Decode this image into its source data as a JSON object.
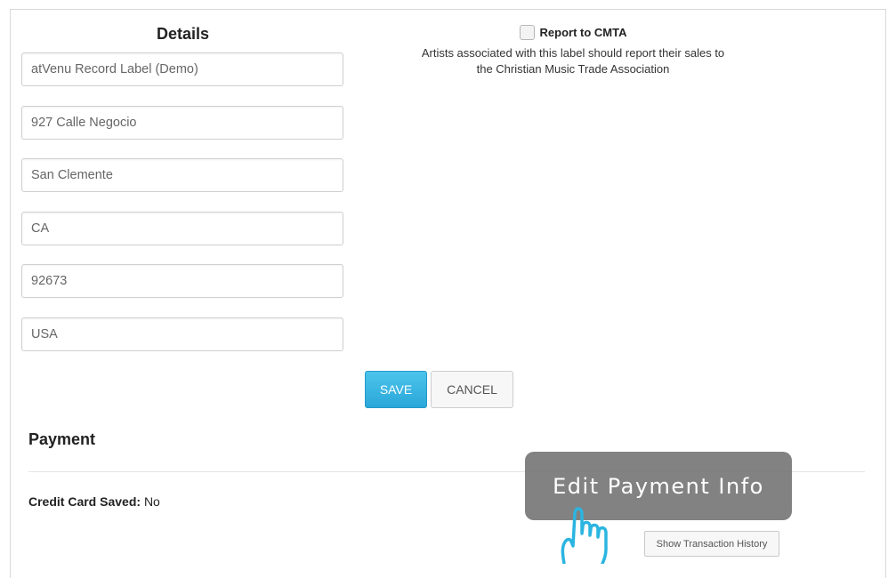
{
  "details": {
    "title": "Details",
    "fields": [
      {
        "value": "atVenu Record Label (Demo)"
      },
      {
        "value": "927 Calle Negocio"
      },
      {
        "value": "San Clemente"
      },
      {
        "value": "CA"
      },
      {
        "value": "92673"
      },
      {
        "value": "USA"
      }
    ]
  },
  "cmta": {
    "checked": false,
    "label": "Report to CMTA",
    "help_line1": "Artists associated with this label should report their sales to",
    "help_line2": "the Christian Music Trade Association"
  },
  "actions": {
    "save_label": "SAVE",
    "cancel_label": "CANCEL"
  },
  "payment": {
    "title": "Payment",
    "cc_label": "Credit Card Saved:",
    "cc_value": "No",
    "history_label": "Show Transaction History"
  },
  "tooltip": {
    "text": "Edit Payment Info",
    "icon": "pointer-hand-icon"
  },
  "colors": {
    "save_button": "#2aa7d9",
    "hand_stroke": "#2bb5e0",
    "tooltip_bg": "#787878"
  }
}
